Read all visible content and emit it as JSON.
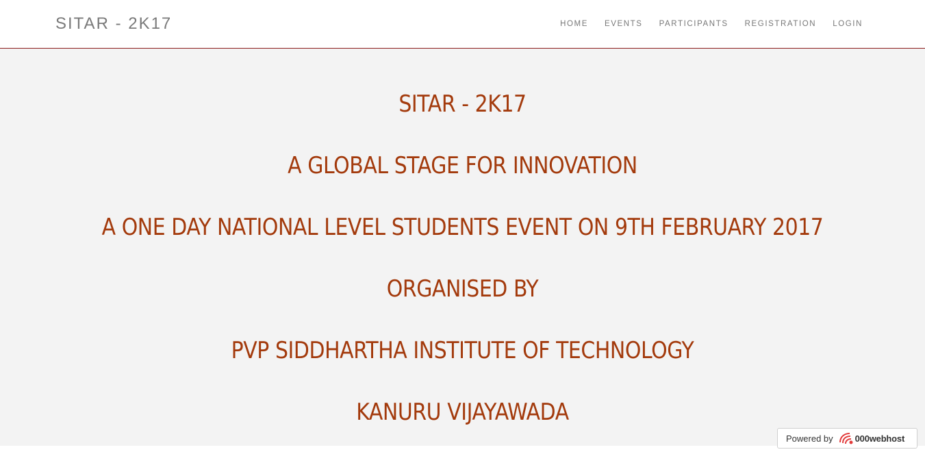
{
  "navbar": {
    "brand": "SITAR - 2K17",
    "links": [
      "HOME",
      "EVENTS",
      "PARTICIPANTS",
      "REGISTRATION",
      "LOGIN"
    ]
  },
  "hero": {
    "lines": [
      "SITAR - 2K17",
      "A GLOBAL STAGE FOR INNOVATION",
      "A ONE DAY NATIONAL LEVEL STUDENTS EVENT ON 9TH FEBRUARY 2017",
      "ORGANISED BY",
      "PVP SIDDHARTHA INSTITUTE OF TECHNOLOGY",
      "KANURU VIJAYAWADA"
    ]
  },
  "badge": {
    "powered_by": "Powered by",
    "host_name": "000webhost",
    "icon": "000webhost-logo-icon"
  },
  "colors": {
    "accent": "#a33a0c",
    "navbar_border": "#8b1a1a",
    "hero_bg": "#f3f3f3"
  }
}
